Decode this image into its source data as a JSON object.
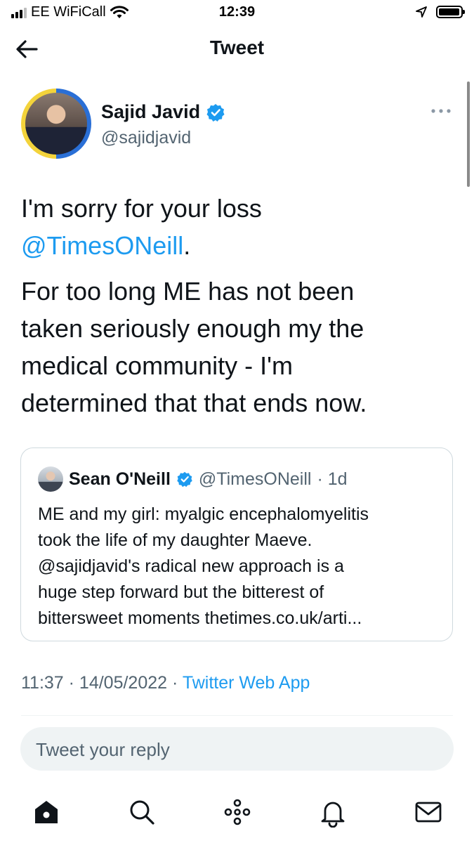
{
  "status_bar": {
    "carrier": "EE WiFiCall",
    "time": "12:39",
    "battery_level": 0.95
  },
  "header": {
    "title": "Tweet",
    "back_icon": "arrow-left-icon"
  },
  "tweet": {
    "author": {
      "name": "Sajid Javid",
      "handle": "@sajidjavid",
      "verified": true
    },
    "paragraph1_prefix": "I'm sorry for your loss",
    "paragraph1_mention": "@TimesONeill",
    "paragraph1_suffix": ".",
    "paragraph2_lines": [
      "For too long ME has not been",
      "taken seriously enough my the",
      "medical community - I'm",
      "determined that that ends now."
    ],
    "timestamp": "11:37 · 14/05/2022 · ",
    "source": "Twitter Web App"
  },
  "quoted_tweet": {
    "author_name": "Sean O'Neill",
    "author_handle": "@TimesONeill",
    "age": "· 1d",
    "verified": true,
    "lines": [
      "ME and my girl: myalgic encephalomyelitis",
      "took the life of my daughter Maeve.",
      "@sajidjavid's radical new approach is a",
      "huge step forward but the bitterest of",
      "bittersweet moments  thetimes.co.uk/arti..."
    ]
  },
  "reply": {
    "placeholder": "Tweet your reply"
  },
  "tab_bar": {
    "tabs": [
      "home-icon",
      "search-icon",
      "spaces-icon",
      "notifications-icon",
      "messages-icon"
    ]
  },
  "colors": {
    "accent": "#1d9bf0",
    "secondary_text": "#536471",
    "reply_bg": "#eff3f4"
  }
}
